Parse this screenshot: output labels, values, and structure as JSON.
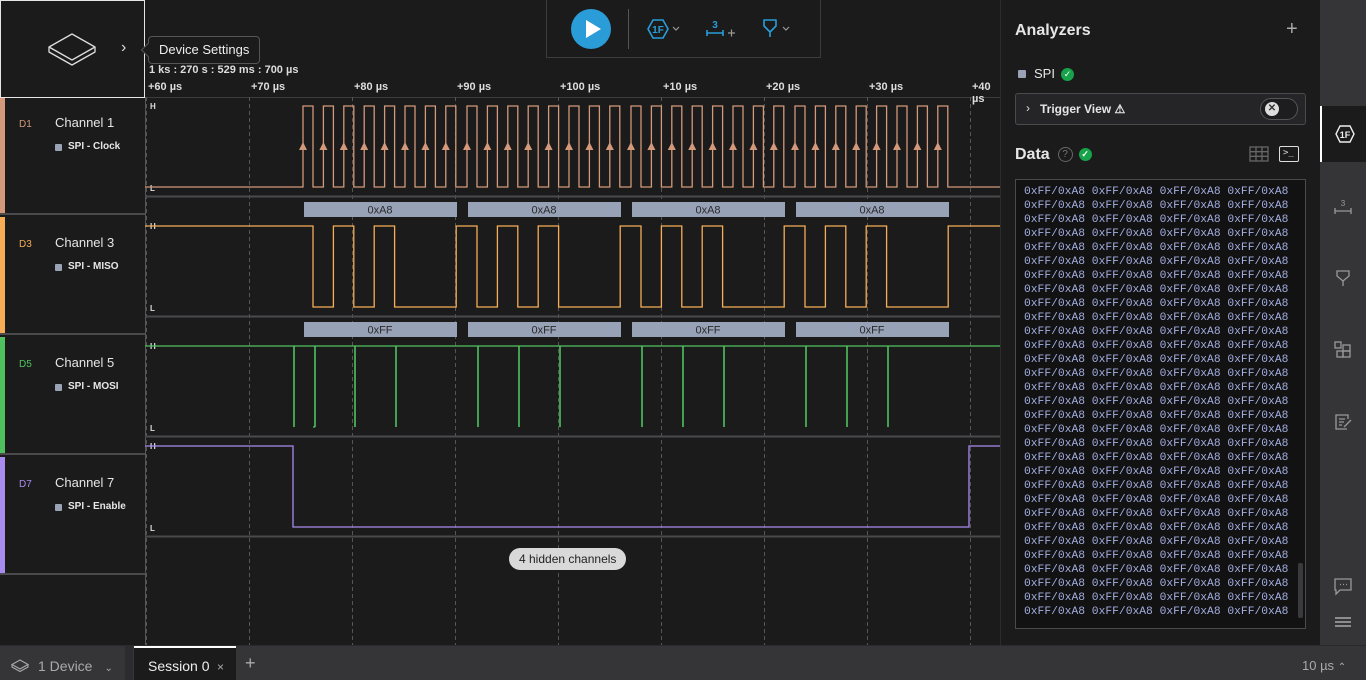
{
  "device_panel": {
    "tooltip": "Device Settings"
  },
  "timeline": {
    "timestamp": "1 ks : 270 s : 529 ms : 700 µs",
    "ticks": [
      "+60 µs",
      "+70 µs",
      "+80 µs",
      "+90 µs",
      "+100 µs",
      "+10 µs",
      "+20 µs",
      "+30 µs",
      "+40 µs"
    ]
  },
  "channels": [
    {
      "id": "D1",
      "name": "Channel 1",
      "analyzer_label": "SPI - Clock",
      "color": "#d4987a"
    },
    {
      "id": "D3",
      "name": "Channel 3",
      "analyzer_label": "SPI - MISO",
      "color": "#f6ad55"
    },
    {
      "id": "D5",
      "name": "Channel 5",
      "analyzer_label": "SPI - MOSI",
      "color": "#4fc25f"
    },
    {
      "id": "D7",
      "name": "Channel 7",
      "analyzer_label": "SPI - Enable",
      "color": "#a98bf0"
    }
  ],
  "level_labels": {
    "high": "H",
    "low": "L"
  },
  "decoded": {
    "miso": [
      "0xA8",
      "0xA8",
      "0xA8",
      "0xA8"
    ],
    "mosi": [
      "0xFF",
      "0xFF",
      "0xFF",
      "0xFF"
    ]
  },
  "hidden_channels": "4 hidden channels",
  "toolbar": {
    "play_label": "Start",
    "trigger_label": "1F",
    "measure_label": "3",
    "plus": "+"
  },
  "analyzers": {
    "title": "Analyzers",
    "add": "+",
    "items": [
      {
        "name": "SPI",
        "status": "ok"
      }
    ],
    "trigger_view": {
      "label": "Trigger View",
      "warning": "⚠",
      "enabled": false
    }
  },
  "data_panel": {
    "title": "Data",
    "help": "?",
    "row_count": 31,
    "entries_per_row": 4,
    "entry": "0xFF/0xA8"
  },
  "bottom": {
    "device_label": "1 Device",
    "session_tab": "Session 0",
    "close": "×",
    "add_tab": "+",
    "zoom_level": "10 µs"
  }
}
